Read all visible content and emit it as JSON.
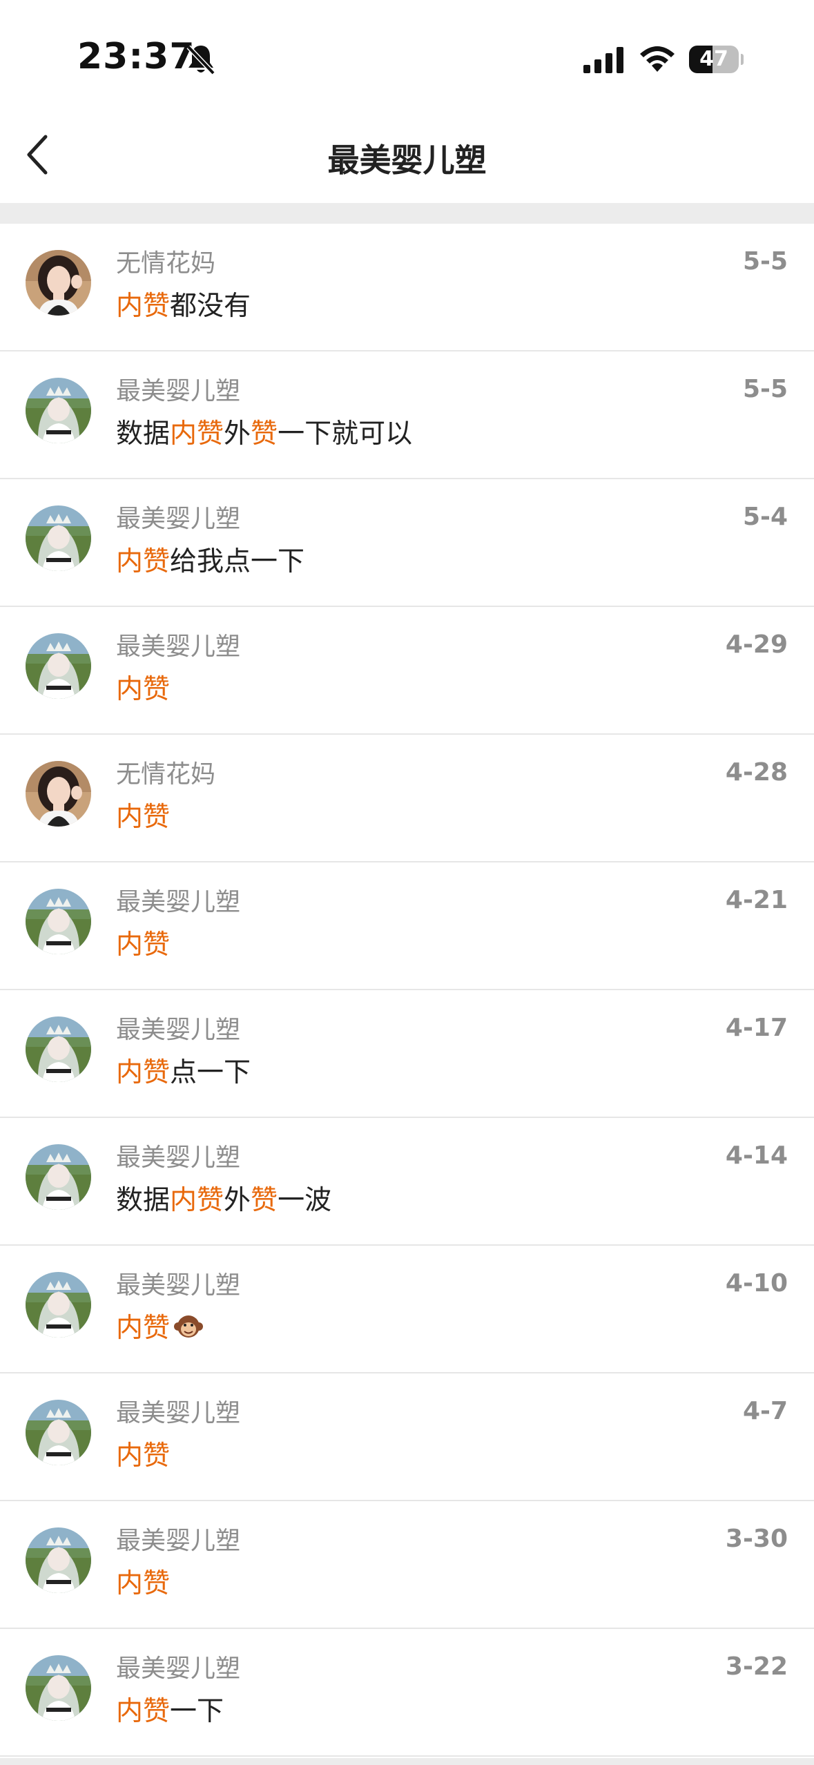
{
  "status_bar": {
    "time": "23:37",
    "battery": "47",
    "battery_level": 0.47
  },
  "nav": {
    "title": "最美婴儿塑"
  },
  "colors": {
    "highlight": "#e8690c",
    "muted": "#8d8d8d",
    "text": "#222222"
  },
  "rows": [
    {
      "name": "无情花妈",
      "date": "5-5",
      "avatar": "woman-avatar",
      "message": [
        {
          "text": "内赞",
          "hl": true
        },
        {
          "text": "都没有",
          "hl": false
        }
      ]
    },
    {
      "name": "最美婴儿塑",
      "date": "5-5",
      "avatar": "anime-avatar",
      "message": [
        {
          "text": "数据",
          "hl": false
        },
        {
          "text": "内赞",
          "hl": true
        },
        {
          "text": "外",
          "hl": false
        },
        {
          "text": "赞",
          "hl": true
        },
        {
          "text": "一下就可以",
          "hl": false
        }
      ]
    },
    {
      "name": "最美婴儿塑",
      "date": "5-4",
      "avatar": "anime-avatar",
      "message": [
        {
          "text": "内赞",
          "hl": true
        },
        {
          "text": "给我点一下",
          "hl": false
        }
      ]
    },
    {
      "name": "最美婴儿塑",
      "date": "4-29",
      "avatar": "anime-avatar",
      "message": [
        {
          "text": "内赞",
          "hl": true
        }
      ]
    },
    {
      "name": "无情花妈",
      "date": "4-28",
      "avatar": "woman-avatar",
      "message": [
        {
          "text": "内赞",
          "hl": true
        }
      ]
    },
    {
      "name": "最美婴儿塑",
      "date": "4-21",
      "avatar": "anime-avatar",
      "message": [
        {
          "text": "内赞",
          "hl": true
        }
      ]
    },
    {
      "name": "最美婴儿塑",
      "date": "4-17",
      "avatar": "anime-avatar",
      "message": [
        {
          "text": "内赞",
          "hl": true
        },
        {
          "text": "点一下",
          "hl": false
        }
      ]
    },
    {
      "name": "最美婴儿塑",
      "date": "4-14",
      "avatar": "anime-avatar",
      "message": [
        {
          "text": "数据",
          "hl": false
        },
        {
          "text": "内赞",
          "hl": true
        },
        {
          "text": "外",
          "hl": false
        },
        {
          "text": "赞",
          "hl": true
        },
        {
          "text": "一波",
          "hl": false
        }
      ]
    },
    {
      "name": "最美婴儿塑",
      "date": "4-10",
      "avatar": "anime-avatar",
      "message": [
        {
          "text": "内赞",
          "hl": true
        }
      ],
      "emoji": "monkey-face-emoji"
    },
    {
      "name": "最美婴儿塑",
      "date": "4-7",
      "avatar": "anime-avatar",
      "message": [
        {
          "text": "内赞",
          "hl": true
        }
      ]
    },
    {
      "name": "最美婴儿塑",
      "date": "3-30",
      "avatar": "anime-avatar",
      "message": [
        {
          "text": "内赞",
          "hl": true
        }
      ]
    },
    {
      "name": "最美婴儿塑",
      "date": "3-22",
      "avatar": "anime-avatar",
      "message": [
        {
          "text": "内赞",
          "hl": true
        },
        {
          "text": "一下",
          "hl": false
        }
      ]
    }
  ]
}
